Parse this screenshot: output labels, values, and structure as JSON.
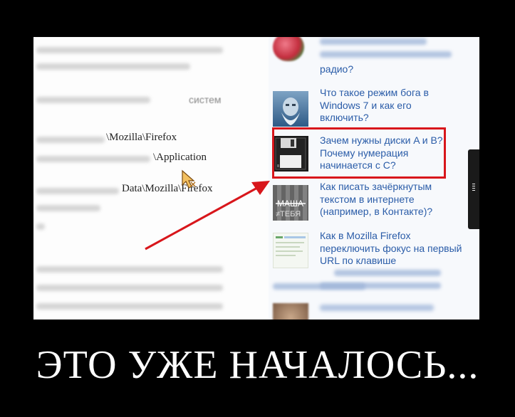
{
  "article": {
    "line_systems": "систем",
    "line_firefox": "\\Mozilla\\Firefox",
    "line_application": "\\Application",
    "line_appdata": "Data\\Mozilla\\Firefox"
  },
  "sidebar": {
    "items": [
      {
        "title": "радио?",
        "thumb_icon": "radio-thumbnail"
      },
      {
        "title": "Что такое режим бога в Windows 7 и как его включить?",
        "thumb_icon": "god-face-thumbnail"
      },
      {
        "title": "Зачем нужны диски A и B? Почему нумерация начинается с C?",
        "thumb_icon": "floppy-disk-thumbnail"
      },
      {
        "title": "Как писать зачёркнутым текстом в интернете (например, в Контакте)?",
        "thumb_icon": "strikethrough-thumbnail"
      },
      {
        "title": "Как в Mozilla Firefox переключить фокус на первый URL по клавише",
        "thumb_icon": "browser-thumbnail"
      }
    ]
  },
  "caption": "ЭТО УЖЕ НАЧАЛОСЬ...",
  "colors": {
    "highlight": "#d8161b",
    "link": "#2a5ca8",
    "background": "#000000"
  }
}
